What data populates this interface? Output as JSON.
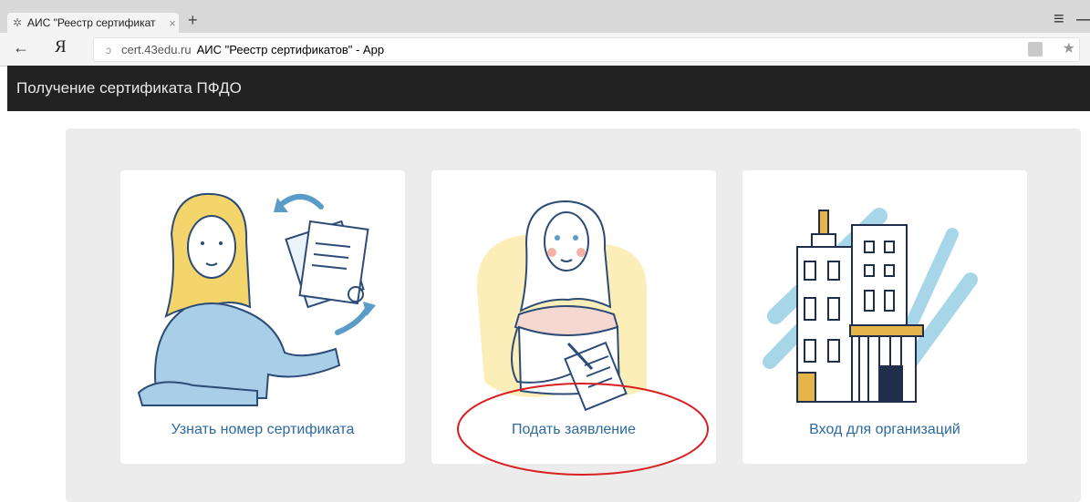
{
  "browser": {
    "tab_title": "АИС \"Реестр сертификат",
    "tab_close": "×",
    "new_tab": "+",
    "menu_glyph": "≡",
    "minimize_glyph": "—",
    "back_glyph": "←",
    "yandex_glyph": "Я",
    "reload_glyph": "ↄ",
    "url_domain": "cert.43edu.ru",
    "url_page_title": "АИС \"Реестр сертификатов\" - App",
    "star_glyph": "★"
  },
  "header": {
    "title": "Получение сертификата ПФДО"
  },
  "cards": [
    {
      "label": "Узнать номер сертификата",
      "icon": "woman-with-documents-illustration"
    },
    {
      "label": "Подать заявление",
      "icon": "woman-filling-form-illustration"
    },
    {
      "label": "Вход для организаций",
      "icon": "office-building-illustration"
    }
  ],
  "colors": {
    "header_bg": "#222222",
    "panel_bg": "#ececec",
    "link": "#2c6aa0",
    "annotation": "#d92020"
  }
}
